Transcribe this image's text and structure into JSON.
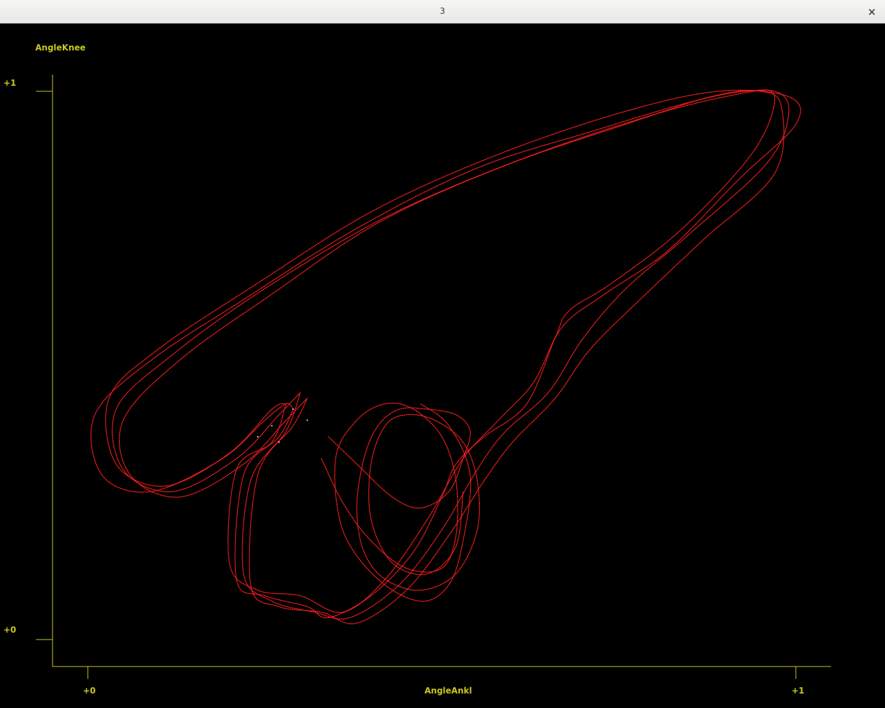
{
  "window": {
    "title": "3",
    "close_glyph": "×"
  },
  "colors": {
    "background": "#000000",
    "axis": "#c8c81e",
    "trace": "#ff1e1e",
    "trace_highlight": "#ffffff"
  },
  "chart_data": {
    "type": "scatter",
    "xlabel": "AngleAnkl",
    "ylabel": "AngleKnee",
    "xlim": [
      0,
      1
    ],
    "ylim": [
      0,
      1
    ],
    "x_ticks": [
      "+0",
      "+1"
    ],
    "y_ticks": [
      "+0",
      "+1"
    ],
    "grid": false,
    "style": "phase-portrait, dense dotted red trajectories (approximate)",
    "series": [
      {
        "points": [
          [
            0.29,
            0.42
          ],
          [
            0.27,
            0.37
          ],
          [
            0.22,
            0.3
          ],
          [
            0.21,
            0.11
          ],
          [
            0.25,
            0.08
          ],
          [
            0.31,
            0.06
          ],
          [
            0.34,
            0.04
          ],
          [
            0.4,
            0.08
          ],
          [
            0.46,
            0.16
          ],
          [
            0.5,
            0.26
          ],
          [
            0.52,
            0.32
          ],
          [
            0.56,
            0.37
          ],
          [
            0.62,
            0.43
          ],
          [
            0.66,
            0.55
          ],
          [
            0.68,
            0.6
          ],
          [
            0.74,
            0.65
          ],
          [
            0.84,
            0.75
          ],
          [
            0.94,
            0.89
          ],
          [
            0.97,
            0.99
          ],
          [
            0.93,
            1.0
          ],
          [
            0.85,
            0.98
          ],
          [
            0.72,
            0.93
          ],
          [
            0.55,
            0.86
          ],
          [
            0.38,
            0.75
          ],
          [
            0.22,
            0.62
          ],
          [
            0.09,
            0.51
          ],
          [
            0.01,
            0.41
          ],
          [
            0.02,
            0.3
          ],
          [
            0.09,
            0.27
          ],
          [
            0.19,
            0.33
          ],
          [
            0.25,
            0.4
          ],
          [
            0.28,
            0.43
          ],
          [
            0.29,
            0.42
          ]
        ]
      },
      {
        "points": [
          [
            0.3,
            0.45
          ],
          [
            0.28,
            0.38
          ],
          [
            0.23,
            0.29
          ],
          [
            0.22,
            0.12
          ],
          [
            0.26,
            0.07
          ],
          [
            0.32,
            0.05
          ],
          [
            0.37,
            0.04
          ],
          [
            0.44,
            0.1
          ],
          [
            0.5,
            0.2
          ],
          [
            0.55,
            0.31
          ],
          [
            0.59,
            0.38
          ],
          [
            0.65,
            0.45
          ],
          [
            0.7,
            0.55
          ],
          [
            0.76,
            0.64
          ],
          [
            0.85,
            0.74
          ],
          [
            0.96,
            0.87
          ],
          [
            0.99,
            0.96
          ],
          [
            0.97,
            1.0
          ],
          [
            0.9,
            0.99
          ],
          [
            0.78,
            0.95
          ],
          [
            0.6,
            0.87
          ],
          [
            0.42,
            0.77
          ],
          [
            0.25,
            0.64
          ],
          [
            0.12,
            0.52
          ],
          [
            0.04,
            0.42
          ],
          [
            0.05,
            0.31
          ],
          [
            0.12,
            0.27
          ],
          [
            0.21,
            0.33
          ],
          [
            0.27,
            0.41
          ],
          [
            0.3,
            0.45
          ]
        ]
      },
      {
        "points": [
          [
            0.28,
            0.43
          ],
          [
            0.26,
            0.36
          ],
          [
            0.21,
            0.31
          ],
          [
            0.2,
            0.14
          ],
          [
            0.24,
            0.09
          ],
          [
            0.3,
            0.08
          ],
          [
            0.36,
            0.05
          ],
          [
            0.42,
            0.11
          ],
          [
            0.48,
            0.22
          ],
          [
            0.53,
            0.33
          ],
          [
            0.58,
            0.4
          ],
          [
            0.63,
            0.47
          ],
          [
            0.67,
            0.57
          ],
          [
            0.73,
            0.63
          ],
          [
            0.82,
            0.71
          ],
          [
            0.92,
            0.84
          ],
          [
            1.0,
            0.94
          ],
          [
            0.99,
            0.99
          ],
          [
            0.89,
            1.0
          ],
          [
            0.75,
            0.96
          ],
          [
            0.57,
            0.88
          ],
          [
            0.4,
            0.78
          ],
          [
            0.24,
            0.65
          ],
          [
            0.1,
            0.53
          ],
          [
            0.03,
            0.44
          ],
          [
            0.04,
            0.32
          ],
          [
            0.11,
            0.28
          ],
          [
            0.2,
            0.34
          ],
          [
            0.26,
            0.42
          ],
          [
            0.28,
            0.43
          ]
        ]
      },
      {
        "points": [
          [
            0.31,
            0.44
          ],
          [
            0.29,
            0.39
          ],
          [
            0.24,
            0.3
          ],
          [
            0.23,
            0.1
          ],
          [
            0.27,
            0.06
          ],
          [
            0.33,
            0.05
          ],
          [
            0.38,
            0.03
          ],
          [
            0.45,
            0.09
          ],
          [
            0.51,
            0.19
          ],
          [
            0.56,
            0.29
          ],
          [
            0.6,
            0.36
          ],
          [
            0.66,
            0.44
          ],
          [
            0.71,
            0.53
          ],
          [
            0.78,
            0.62
          ],
          [
            0.87,
            0.73
          ],
          [
            0.97,
            0.85
          ],
          [
            0.98,
            0.97
          ],
          [
            0.95,
            1.0
          ],
          [
            0.88,
            0.99
          ],
          [
            0.76,
            0.94
          ],
          [
            0.58,
            0.86
          ],
          [
            0.41,
            0.76
          ],
          [
            0.26,
            0.63
          ],
          [
            0.13,
            0.51
          ],
          [
            0.05,
            0.4
          ],
          [
            0.06,
            0.3
          ],
          [
            0.13,
            0.26
          ],
          [
            0.22,
            0.32
          ],
          [
            0.28,
            0.4
          ],
          [
            0.31,
            0.44
          ]
        ]
      },
      {
        "points": [
          [
            0.34,
            0.37
          ],
          [
            0.38,
            0.32
          ],
          [
            0.43,
            0.26
          ],
          [
            0.47,
            0.24
          ],
          [
            0.51,
            0.27
          ],
          [
            0.53,
            0.33
          ],
          [
            0.54,
            0.38
          ],
          [
            0.52,
            0.41
          ],
          [
            0.48,
            0.42
          ],
          [
            0.44,
            0.42
          ],
          [
            0.41,
            0.39
          ],
          [
            0.39,
            0.33
          ],
          [
            0.38,
            0.24
          ],
          [
            0.39,
            0.16
          ],
          [
            0.42,
            0.11
          ],
          [
            0.47,
            0.09
          ],
          [
            0.52,
            0.12
          ],
          [
            0.55,
            0.2
          ],
          [
            0.55,
            0.29
          ],
          [
            0.53,
            0.36
          ],
          [
            0.49,
            0.4
          ],
          [
            0.45,
            0.41
          ],
          [
            0.42,
            0.39
          ],
          [
            0.4,
            0.32
          ],
          [
            0.4,
            0.22
          ],
          [
            0.43,
            0.14
          ],
          [
            0.48,
            0.12
          ],
          [
            0.52,
            0.17
          ],
          [
            0.53,
            0.27
          ]
        ]
      },
      {
        "points": [
          [
            0.33,
            0.33
          ],
          [
            0.36,
            0.25
          ],
          [
            0.4,
            0.18
          ],
          [
            0.45,
            0.13
          ],
          [
            0.5,
            0.13
          ],
          [
            0.52,
            0.19
          ],
          [
            0.52,
            0.29
          ],
          [
            0.5,
            0.37
          ],
          [
            0.46,
            0.42
          ],
          [
            0.42,
            0.43
          ],
          [
            0.38,
            0.4
          ],
          [
            0.35,
            0.33
          ],
          [
            0.36,
            0.2
          ],
          [
            0.41,
            0.11
          ],
          [
            0.47,
            0.07
          ],
          [
            0.51,
            0.1
          ],
          [
            0.53,
            0.18
          ],
          [
            0.54,
            0.3
          ],
          [
            0.51,
            0.39
          ],
          [
            0.47,
            0.43
          ]
        ]
      }
    ]
  }
}
